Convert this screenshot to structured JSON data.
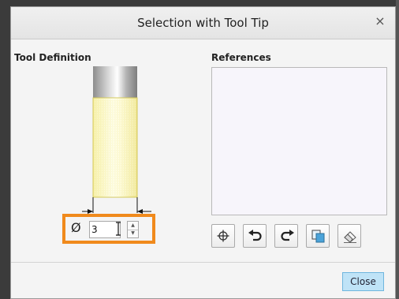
{
  "dialog": {
    "title": "Selection with Tool Tip",
    "close_icon": "×"
  },
  "tool_definition": {
    "label": "Tool Definition",
    "diameter_symbol": "Ø",
    "diameter_value": "3"
  },
  "references": {
    "label": "References",
    "items": []
  },
  "toolbar": {
    "buttons": [
      "crosshair-icon",
      "undo-icon",
      "redo-icon",
      "copy-icon",
      "eraser-icon"
    ]
  },
  "footer": {
    "close_label": "Close"
  },
  "colors": {
    "highlight_border": "#f08a1c",
    "tool_body": "#fffcc8",
    "close_button_bg": "#bfe3f7"
  }
}
